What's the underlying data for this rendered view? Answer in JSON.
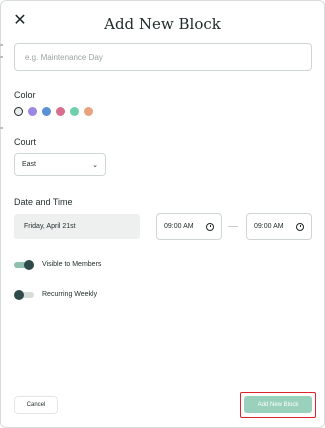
{
  "modal": {
    "title": "Add New Block",
    "close_icon": "close-icon"
  },
  "name_field": {
    "value": "",
    "placeholder": "e.g. Maintenance Day"
  },
  "color": {
    "label": "Color",
    "swatches": [
      {
        "color": "#e9ecec",
        "selected": true
      },
      {
        "color": "#9b86e3",
        "selected": false
      },
      {
        "color": "#5b8fd6",
        "selected": false
      },
      {
        "color": "#d86f8d",
        "selected": false
      },
      {
        "color": "#6fcfa9",
        "selected": false
      },
      {
        "color": "#e8a37e",
        "selected": false
      }
    ]
  },
  "court": {
    "label": "Court",
    "selected": "East",
    "icon": "chevron-down-icon"
  },
  "date_time": {
    "label": "Date and Time",
    "date": "Friday, April 21st",
    "start_time": "09:00 AM",
    "end_time": "09:00 AM",
    "separator": "—"
  },
  "toggles": [
    {
      "label": "Visible to Members",
      "on": true
    },
    {
      "label": "Recurring Weekly",
      "on": false
    }
  ],
  "footer": {
    "cancel_label": "Cancel",
    "submit_label": "Add New Block"
  },
  "colors": {
    "accent": "#9ad1bc",
    "toggle_on_track": "#8fbfb0",
    "toggle_off_track": "#d8dcdc",
    "knob": "#2f4a4a",
    "highlight": "#e0232b"
  }
}
